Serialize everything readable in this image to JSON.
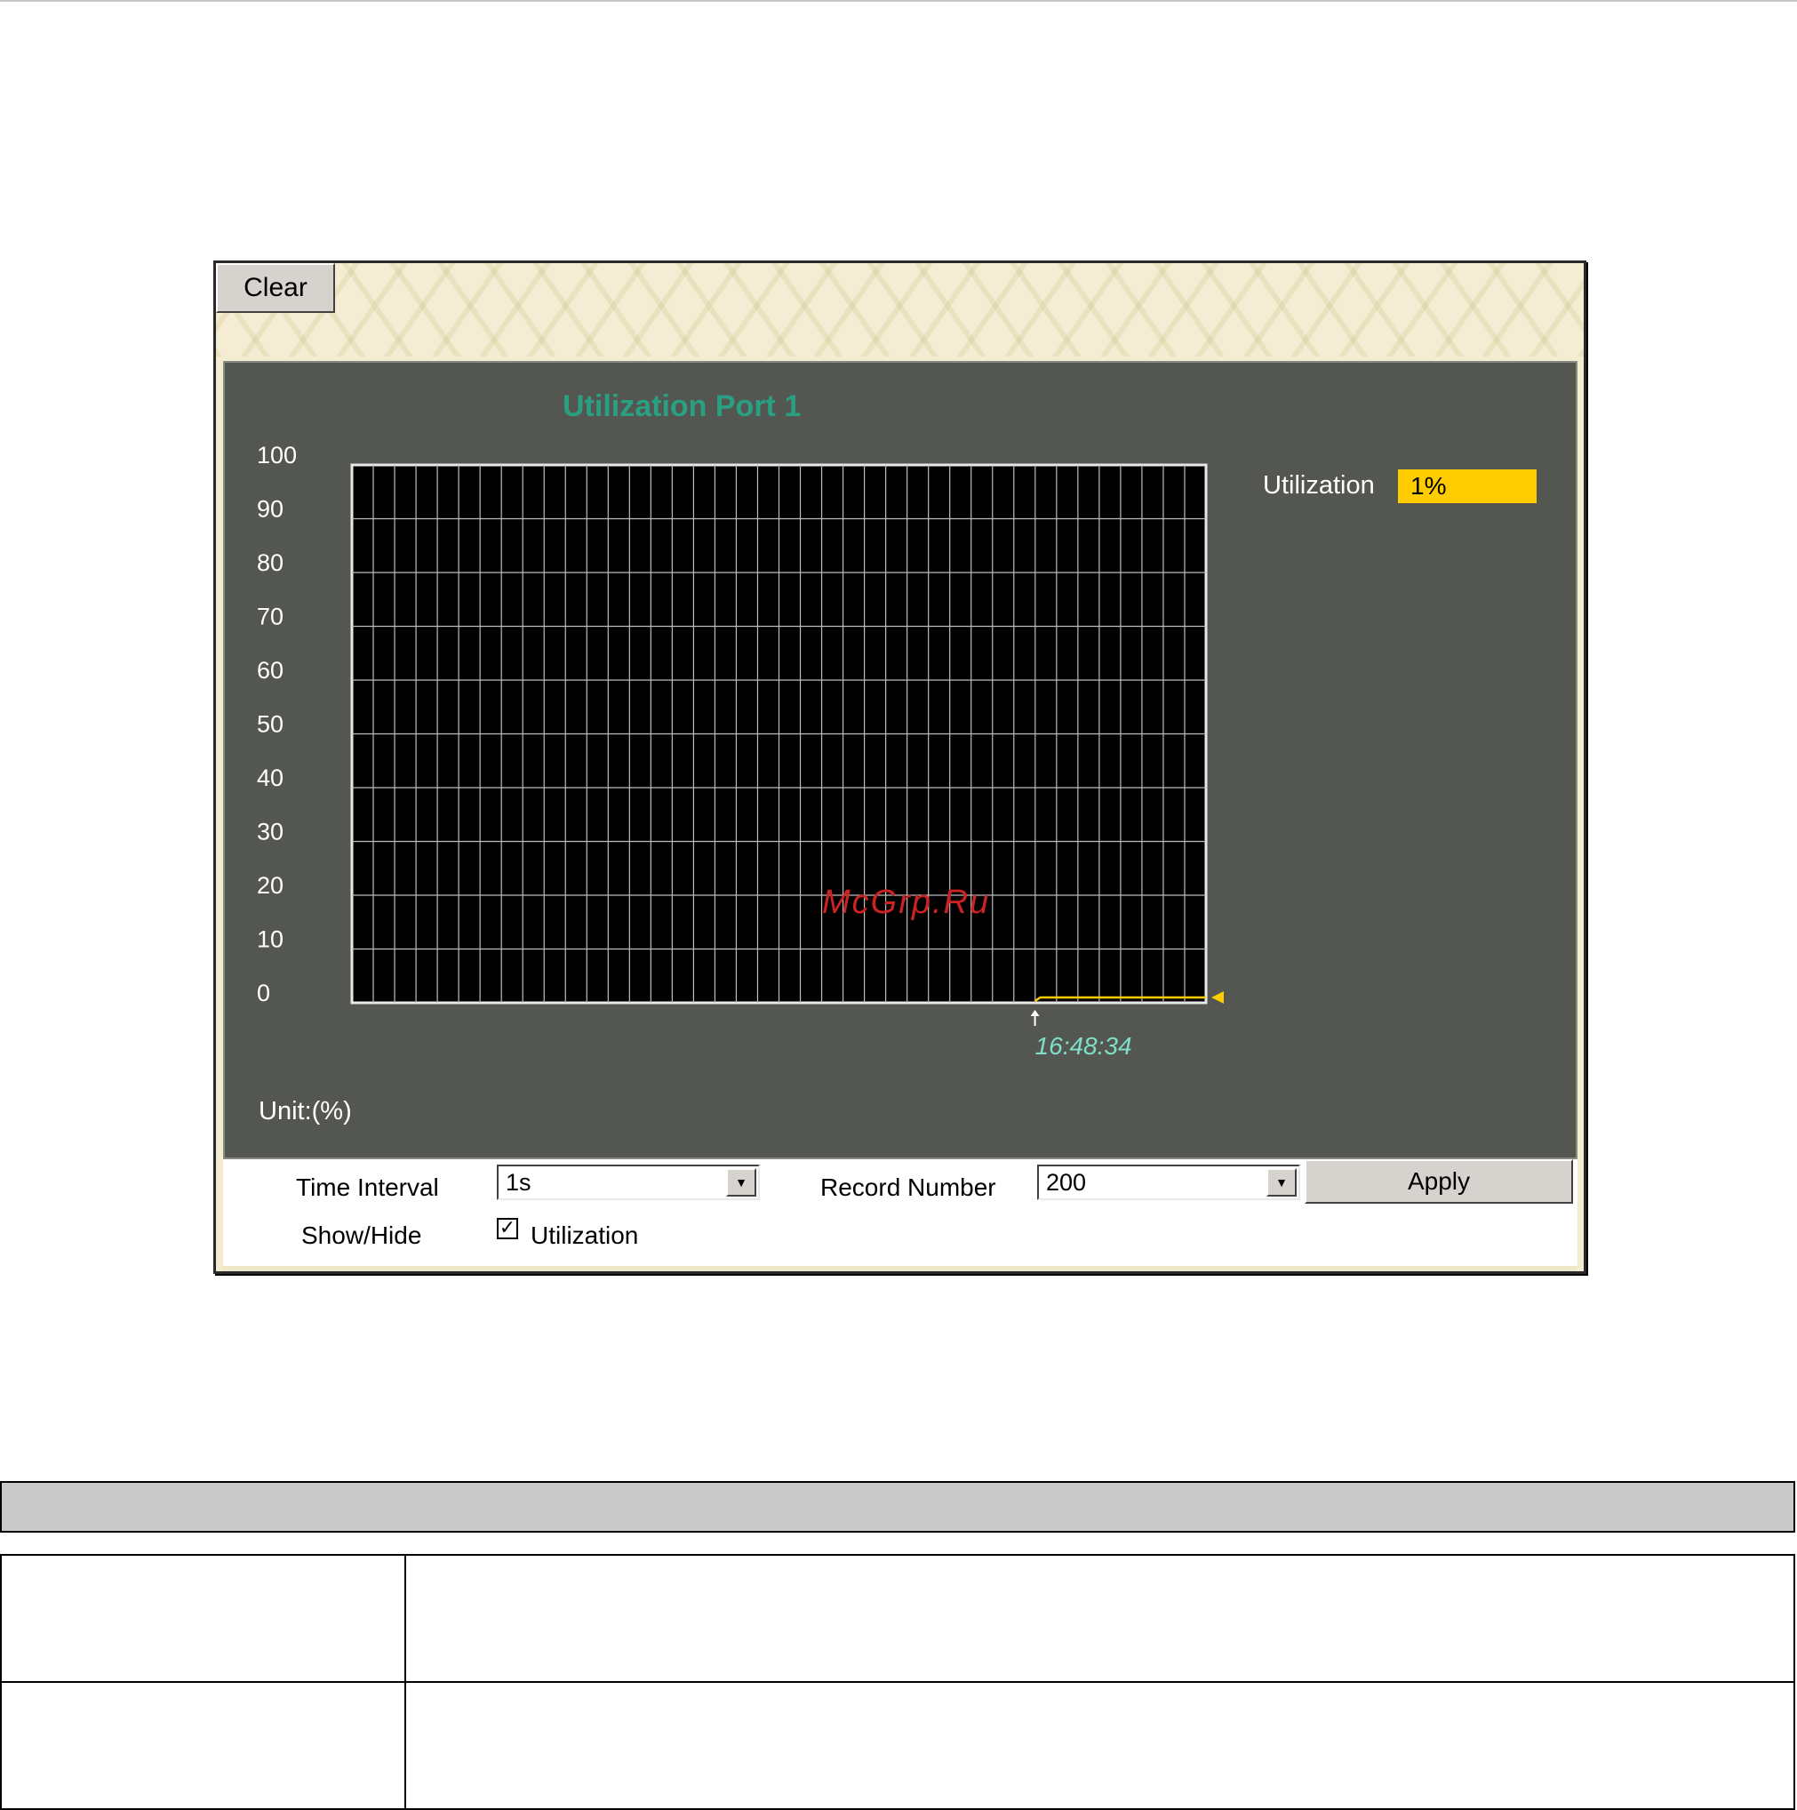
{
  "applet": {
    "clear_label": "Clear",
    "apply_label": "Apply",
    "time_interval_label": "Time Interval",
    "time_interval_value": "1s",
    "record_number_label": "Record Number",
    "record_number_value": "200",
    "show_hide_label": "Show/Hide",
    "show_hide_option": "Utilization",
    "show_hide_checked": true,
    "legend_label": "Utilization",
    "legend_value": "1%",
    "unit_label": "Unit:(%)",
    "watermark": "McGrp.Ru"
  },
  "chart_data": {
    "type": "line",
    "title": "Utilization  Port 1",
    "ylim": [
      0,
      100
    ],
    "y_ticks": [
      "100",
      "90",
      "80",
      "70",
      "60",
      "50",
      "40",
      "30",
      "20",
      "10",
      "0"
    ],
    "time_marker": "16:48:34",
    "grid": true,
    "series": [
      {
        "name": "Utilization",
        "color": "#ffcc00",
        "values": [
          1,
          1,
          1,
          1,
          1,
          1,
          1,
          1,
          1,
          1,
          1,
          1
        ]
      }
    ]
  },
  "colors": {
    "panel_bg": "#545652",
    "plot_bg": "#000000",
    "title": "#2aa083",
    "series": "#ffcc00",
    "time_marker": "#7ee0c8",
    "watermark": "#cc2222"
  },
  "description_table": {
    "header": "",
    "rows": [
      {
        "name": "",
        "description": ""
      },
      {
        "name": "",
        "description": ""
      }
    ]
  }
}
